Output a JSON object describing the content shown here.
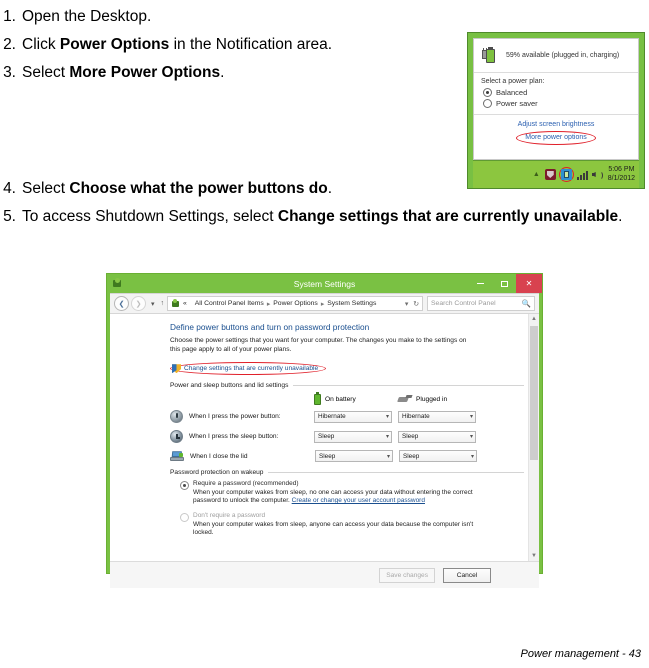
{
  "document": {
    "footer": "Power management -  43"
  },
  "steps": [
    {
      "num": "1.",
      "pre": "Open the Desktop.",
      "bold": "",
      "post": ""
    },
    {
      "num": "2.",
      "pre": "Click ",
      "bold": "Power Options",
      "post": " in the Notification area."
    },
    {
      "num": "3.",
      "pre": "Select ",
      "bold": "More Power Options",
      "post": "."
    },
    {
      "num": "4.",
      "pre": "Select ",
      "bold": "Choose what the power buttons do",
      "post": "."
    },
    {
      "num": "5.",
      "pre": "To access Shutdown Settings, select ",
      "bold": "Change settings that are currently unavailable",
      "post": "."
    }
  ],
  "flyout": {
    "battery_status": "59% available (plugged in, charging)",
    "plan_label": "Select a power plan:",
    "plans": [
      {
        "label": "Balanced",
        "selected": true
      },
      {
        "label": "Power saver",
        "selected": false
      }
    ],
    "links": {
      "brightness": "Adjust screen brightness",
      "more_power": "More power options"
    },
    "taskbar": {
      "time": "5:06 PM",
      "date": "8/1/2012"
    },
    "accent_color": "#78c043",
    "annotation_color": "#e0202a"
  },
  "system_settings": {
    "title": "System Settings",
    "window_buttons": {
      "minimize": "minimize",
      "maximize": "maximize",
      "close": "close"
    },
    "breadcrumb": [
      "All Control Panel Items",
      "Power Options",
      "System Settings"
    ],
    "breadcrumb_prefix": "«",
    "search_placeholder": "Search Control Panel",
    "heading": "Define power buttons and turn on password protection",
    "description": "Choose the power settings that you want for your computer. The changes you make to the settings on this page apply to all of your power plans.",
    "uac_link": "Change settings that are currently unavailable",
    "group1_legend": "Power and sleep buttons and lid settings",
    "columns": [
      "On battery",
      "Plugged in"
    ],
    "rows": [
      {
        "label": "When I press the power button:",
        "on_battery": "Hibernate",
        "plugged_in": "Hibernate",
        "icon": "power-button-icon"
      },
      {
        "label": "When I press the sleep button:",
        "on_battery": "Sleep",
        "plugged_in": "Sleep",
        "icon": "sleep-button-icon"
      },
      {
        "label": "When I close the lid",
        "on_battery": "Sleep",
        "plugged_in": "Sleep",
        "icon": "laptop-lid-icon"
      }
    ],
    "group2_legend": "Password protection on wakeup",
    "password_options": [
      {
        "title": "Require a password (recommended)",
        "selected": true,
        "desc_before": "When your computer wakes from sleep, no one can access your data without entering the correct password to unlock the computer. ",
        "link": "Create or change your user account password",
        "desc_after": ""
      },
      {
        "title": "Don't require a password",
        "selected": false,
        "desc_before": "When your computer wakes from sleep, anyone can access your data because the computer isn't locked.",
        "link": "",
        "desc_after": ""
      }
    ],
    "buttons": {
      "save": "Save changes",
      "cancel": "Cancel"
    },
    "accent_color": "#7ac143",
    "link_color": "#1a4f8f",
    "close_color": "#d8424f"
  }
}
